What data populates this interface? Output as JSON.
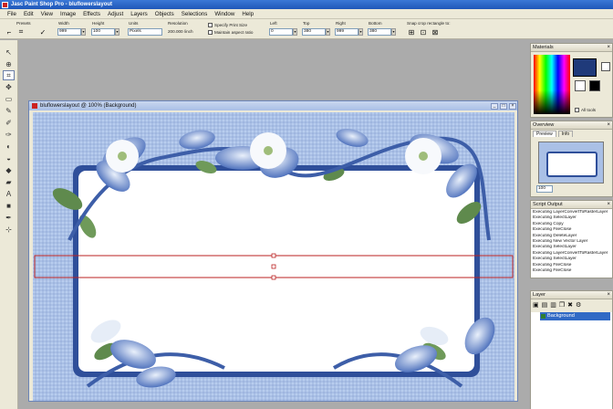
{
  "app": {
    "title": "Jasc Paint Shop Pro - bluflowerslayout"
  },
  "menu": [
    "File",
    "Edit",
    "View",
    "Image",
    "Effects",
    "Adjust",
    "Layers",
    "Objects",
    "Selections",
    "Window",
    "Help"
  ],
  "options": {
    "presets_label": "Presets",
    "width_label": "Width",
    "width_value": "999",
    "height_label": "Height",
    "height_value": "100",
    "units_label": "Units",
    "units_value": "Pixels",
    "resolution_label": "Resolution",
    "resolution_value": "200.000 /inch",
    "specify_print_size": "Specify Print Size",
    "maintain_aspect": "Maintain aspect ratio",
    "left_label": "Left",
    "left_value": "0",
    "top_label": "Top",
    "top_value": "380",
    "right_label": "Right",
    "right_value": "999",
    "bottom_label": "Bottom",
    "bottom_value": "380",
    "snap_label": "Snap crop rectangle to:"
  },
  "image_window": {
    "title": "bluflowerslayout @ 100% (Background)"
  },
  "materials": {
    "title": "Materials",
    "all_tools": "All tools",
    "fg_color": "#1f3a7a",
    "bg_color": "#ffffff"
  },
  "overview": {
    "title": "Overview",
    "tab_preview": "Preview",
    "tab_info": "Info",
    "zoom_value": "100"
  },
  "script_output": {
    "title": "Script Output",
    "lines": [
      "Executing LayerConvertToRasterLayer",
      "Executing SelectLayer",
      "Executing Copy",
      "Executing FileClose",
      "Executing DeleteLayer",
      "Executing New Vector Layer",
      "Executing SelectLayer",
      "Executing LayerConvertToRasterLayer",
      "Executing SelectLayer",
      "Executing FileClose",
      "Executing FileClose"
    ]
  },
  "layers": {
    "title": "Layer",
    "items": [
      {
        "label": "Background"
      }
    ]
  }
}
